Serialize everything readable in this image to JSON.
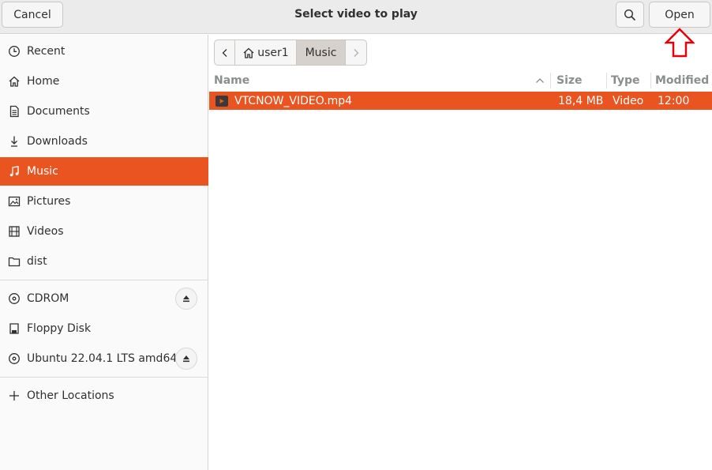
{
  "header": {
    "title": "Select video to play",
    "cancel_label": "Cancel",
    "open_label": "Open",
    "search_icon": "search-icon"
  },
  "sidebar": {
    "places": [
      {
        "label": "Recent",
        "icon": "clock-icon"
      },
      {
        "label": "Home",
        "icon": "home-icon"
      },
      {
        "label": "Documents",
        "icon": "document-icon"
      },
      {
        "label": "Downloads",
        "icon": "download-icon"
      },
      {
        "label": "Music",
        "icon": "music-icon",
        "active": true
      },
      {
        "label": "Pictures",
        "icon": "picture-icon"
      },
      {
        "label": "Videos",
        "icon": "film-icon"
      },
      {
        "label": "dist",
        "icon": "folder-icon"
      }
    ],
    "devices": [
      {
        "label": "CDROM",
        "icon": "disc-icon",
        "ejectable": true
      },
      {
        "label": "Floppy Disk",
        "icon": "drive-icon",
        "ejectable": false
      },
      {
        "label": "Ubuntu 22.04.1 LTS amd64",
        "icon": "disc-icon",
        "ejectable": true
      }
    ],
    "other": {
      "label": "Other Locations",
      "icon": "plus-icon"
    }
  },
  "pathbar": {
    "segments": [
      "user1",
      "Music"
    ]
  },
  "filelist": {
    "columns": {
      "name": "Name",
      "size": "Size",
      "type": "Type",
      "modified": "Modified"
    },
    "sort": "name-ascending",
    "rows": [
      {
        "name": "VTCNOW_VIDEO.mp4",
        "size": "18,4 MB",
        "type": "Video",
        "modified": "12:00",
        "selected": true
      }
    ]
  },
  "colors": {
    "accent": "#e95420",
    "annotation": "#e8000b"
  }
}
